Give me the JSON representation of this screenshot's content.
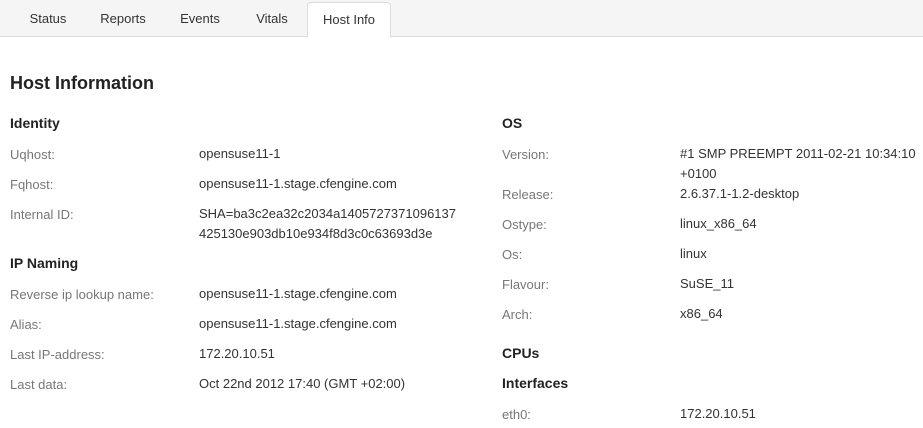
{
  "tabs": [
    "Status",
    "Reports",
    "Events",
    "Vitals",
    "Host Info"
  ],
  "page_title": "Host Information",
  "identity": {
    "title": "Identity",
    "uqhost_label": "Uqhost:",
    "uqhost": "opensuse11-1",
    "fqhost_label": "Fqhost:",
    "fqhost": "opensuse11-1.stage.cfengine.com",
    "internal_id_label": "Internal ID:",
    "internal_id_line1": "SHA=ba3c2ea32c2034a1405727371096137",
    "internal_id_line2": "425130e903db10e934f8d3c0c63693d3e"
  },
  "ip_naming": {
    "title": "IP Naming",
    "reverse_label": "Reverse ip lookup name:",
    "reverse": "opensuse11-1.stage.cfengine.com",
    "alias_label": "Alias:",
    "alias": "opensuse11-1.stage.cfengine.com",
    "last_ip_label": "Last IP-address:",
    "last_ip": "172.20.10.51",
    "last_data_label": "Last data:",
    "last_data": "Oct 22nd 2012 17:40 (GMT +02:00)"
  },
  "os": {
    "title": "OS",
    "version_label": "Version:",
    "version_line1": "#1 SMP PREEMPT 2011-02-21 10:34:10",
    "version_line2": "+0100",
    "release_label": "Release:",
    "release": "2.6.37.1-1.2-desktop",
    "ostype_label": "Ostype:",
    "ostype": "linux_x86_64",
    "os_label": "Os:",
    "os": "linux",
    "flavour_label": "Flavour:",
    "flavour": "SuSE_11",
    "arch_label": "Arch:",
    "arch": "x86_64"
  },
  "cpus": {
    "title": "CPUs"
  },
  "interfaces": {
    "title": "Interfaces",
    "eth0_label": "eth0:",
    "eth0": "172.20.10.51"
  }
}
